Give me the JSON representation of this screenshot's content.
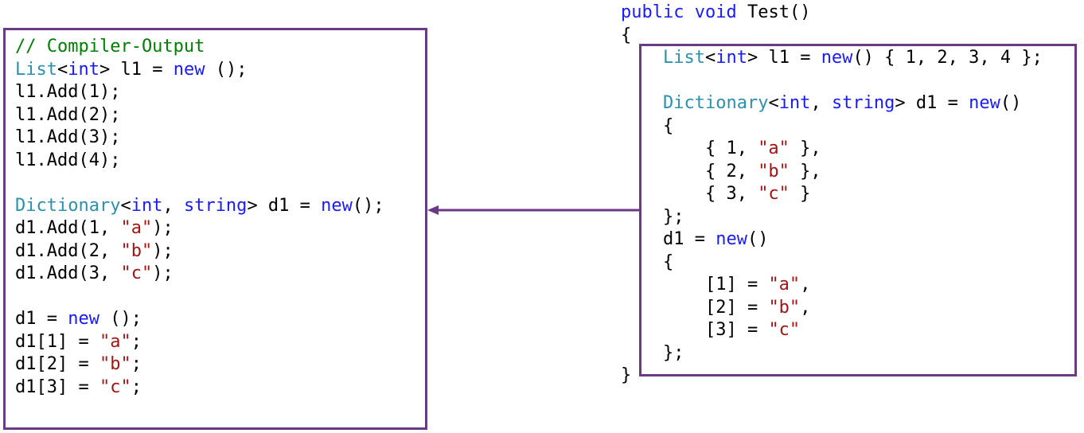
{
  "left_code": [
    [
      {
        "c": "cm",
        "t": "// Compiler-Output"
      }
    ],
    [
      {
        "c": "ty",
        "t": "List"
      },
      {
        "c": "pl",
        "t": "<"
      },
      {
        "c": "kw",
        "t": "int"
      },
      {
        "c": "pl",
        "t": "> l1 = "
      },
      {
        "c": "kw",
        "t": "new"
      },
      {
        "c": "pl",
        "t": " ();"
      }
    ],
    [
      {
        "c": "pl",
        "t": "l1.Add(1);"
      }
    ],
    [
      {
        "c": "pl",
        "t": "l1.Add(2);"
      }
    ],
    [
      {
        "c": "pl",
        "t": "l1.Add(3);"
      }
    ],
    [
      {
        "c": "pl",
        "t": "l1.Add(4);"
      }
    ],
    [],
    [
      {
        "c": "ty",
        "t": "Dictionary"
      },
      {
        "c": "pl",
        "t": "<"
      },
      {
        "c": "kw",
        "t": "int"
      },
      {
        "c": "pl",
        "t": ", "
      },
      {
        "c": "kw",
        "t": "string"
      },
      {
        "c": "pl",
        "t": "> d1 = "
      },
      {
        "c": "kw",
        "t": "new"
      },
      {
        "c": "pl",
        "t": "();"
      }
    ],
    [
      {
        "c": "pl",
        "t": "d1.Add(1, "
      },
      {
        "c": "str",
        "t": "\"a\""
      },
      {
        "c": "pl",
        "t": ");"
      }
    ],
    [
      {
        "c": "pl",
        "t": "d1.Add(2, "
      },
      {
        "c": "str",
        "t": "\"b\""
      },
      {
        "c": "pl",
        "t": ");"
      }
    ],
    [
      {
        "c": "pl",
        "t": "d1.Add(3, "
      },
      {
        "c": "str",
        "t": "\"c\""
      },
      {
        "c": "pl",
        "t": ");"
      }
    ],
    [],
    [
      {
        "c": "pl",
        "t": "d1 = "
      },
      {
        "c": "kw",
        "t": "new"
      },
      {
        "c": "pl",
        "t": " ();"
      }
    ],
    [
      {
        "c": "pl",
        "t": "d1[1] = "
      },
      {
        "c": "str",
        "t": "\"a\""
      },
      {
        "c": "pl",
        "t": ";"
      }
    ],
    [
      {
        "c": "pl",
        "t": "d1[2] = "
      },
      {
        "c": "str",
        "t": "\"b\""
      },
      {
        "c": "pl",
        "t": ";"
      }
    ],
    [
      {
        "c": "pl",
        "t": "d1[3] = "
      },
      {
        "c": "str",
        "t": "\"c\""
      },
      {
        "c": "pl",
        "t": ";"
      }
    ]
  ],
  "right_code": [
    [
      {
        "c": "kw",
        "t": "public"
      },
      {
        "c": "pl",
        "t": " "
      },
      {
        "c": "kw",
        "t": "void"
      },
      {
        "c": "pl",
        "t": " Test()"
      }
    ],
    [
      {
        "c": "pl",
        "t": "{"
      }
    ],
    [
      {
        "c": "pl",
        "t": "    "
      },
      {
        "c": "ty",
        "t": "List"
      },
      {
        "c": "pl",
        "t": "<"
      },
      {
        "c": "kw",
        "t": "int"
      },
      {
        "c": "pl",
        "t": "> l1 = "
      },
      {
        "c": "kw",
        "t": "new"
      },
      {
        "c": "pl",
        "t": "() { 1, 2, 3, 4 };"
      }
    ],
    [],
    [
      {
        "c": "pl",
        "t": "    "
      },
      {
        "c": "ty",
        "t": "Dictionary"
      },
      {
        "c": "pl",
        "t": "<"
      },
      {
        "c": "kw",
        "t": "int"
      },
      {
        "c": "pl",
        "t": ", "
      },
      {
        "c": "kw",
        "t": "string"
      },
      {
        "c": "pl",
        "t": "> d1 = "
      },
      {
        "c": "kw",
        "t": "new"
      },
      {
        "c": "pl",
        "t": "()"
      }
    ],
    [
      {
        "c": "pl",
        "t": "    {"
      }
    ],
    [
      {
        "c": "pl",
        "t": "        { 1, "
      },
      {
        "c": "str",
        "t": "\"a\""
      },
      {
        "c": "pl",
        "t": " },"
      }
    ],
    [
      {
        "c": "pl",
        "t": "        { 2, "
      },
      {
        "c": "str",
        "t": "\"b\""
      },
      {
        "c": "pl",
        "t": " },"
      }
    ],
    [
      {
        "c": "pl",
        "t": "        { 3, "
      },
      {
        "c": "str",
        "t": "\"c\""
      },
      {
        "c": "pl",
        "t": " }"
      }
    ],
    [
      {
        "c": "pl",
        "t": "    };"
      }
    ],
    [
      {
        "c": "pl",
        "t": "    d1 = "
      },
      {
        "c": "kw",
        "t": "new"
      },
      {
        "c": "pl",
        "t": "()"
      }
    ],
    [
      {
        "c": "pl",
        "t": "    {"
      }
    ],
    [
      {
        "c": "pl",
        "t": "        [1] = "
      },
      {
        "c": "str",
        "t": "\"a\""
      },
      {
        "c": "pl",
        "t": ","
      }
    ],
    [
      {
        "c": "pl",
        "t": "        [2] = "
      },
      {
        "c": "str",
        "t": "\"b\""
      },
      {
        "c": "pl",
        "t": ","
      }
    ],
    [
      {
        "c": "pl",
        "t": "        [3] = "
      },
      {
        "c": "str",
        "t": "\"c\""
      }
    ],
    [
      {
        "c": "pl",
        "t": "    };"
      }
    ],
    [
      {
        "c": "pl",
        "t": "}"
      }
    ]
  ],
  "colors": {
    "keyword": "#1a1aff",
    "type": "#2b91af",
    "string": "#a31515",
    "comment": "#008000",
    "border": "#6b3a87"
  }
}
